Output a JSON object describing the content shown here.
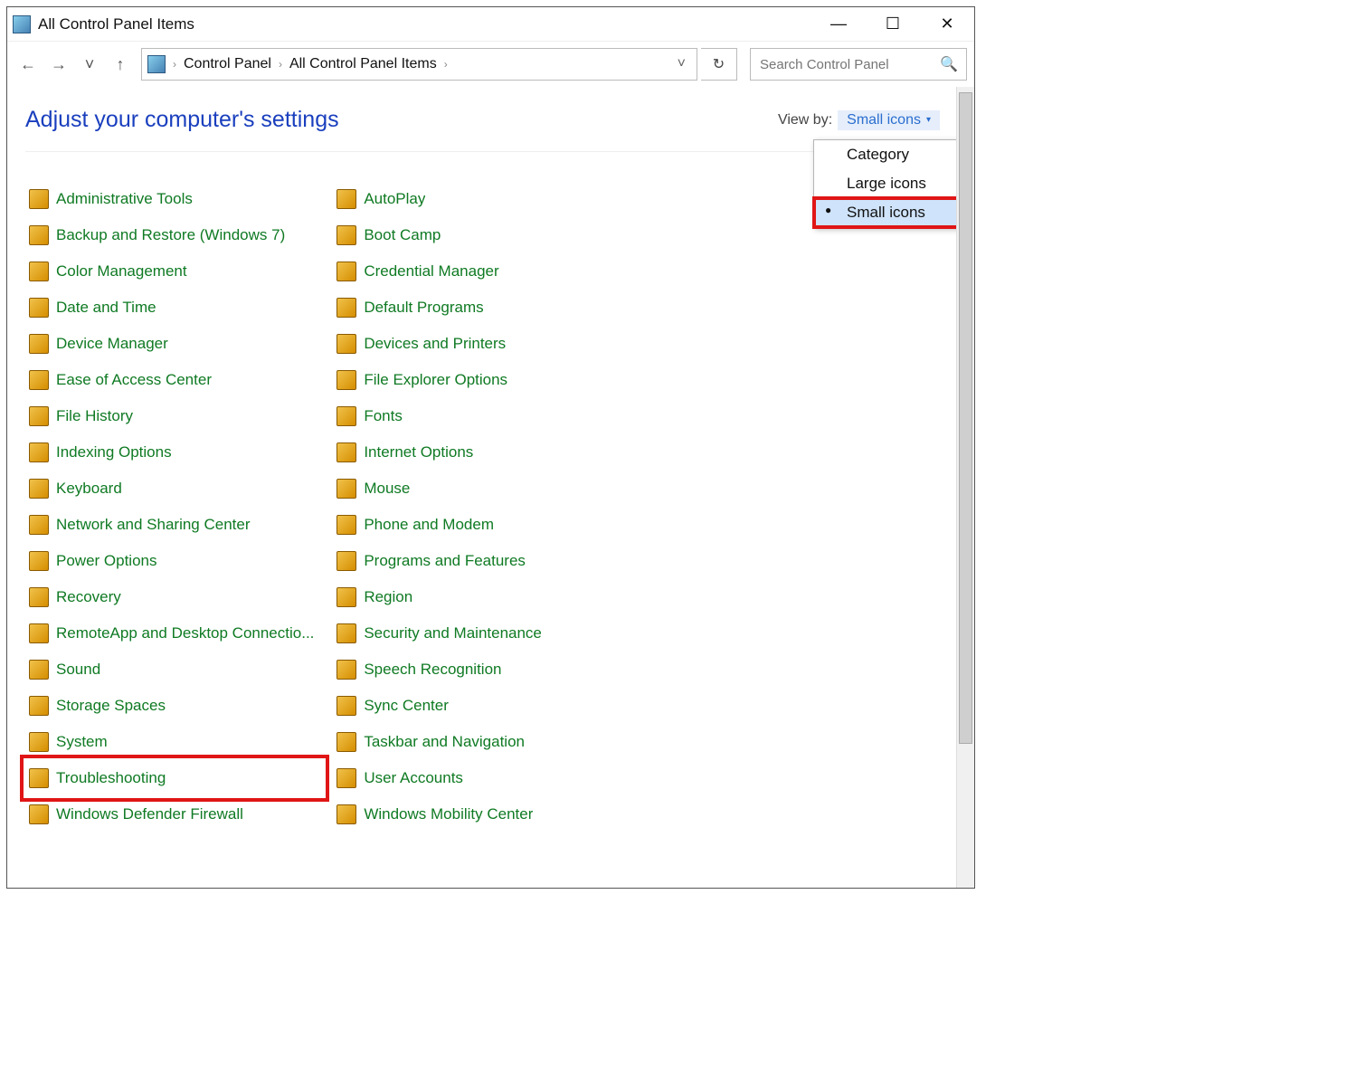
{
  "window": {
    "title": "All Control Panel Items",
    "controls": {
      "min": "—",
      "max": "☐",
      "close": "✕"
    }
  },
  "nav": {
    "back_icon": "←",
    "forward_icon": "→",
    "recent_icon": "˅",
    "up_icon": "↑",
    "refresh_icon": "↻"
  },
  "breadcrumb": {
    "items": [
      "Control Panel",
      "All Control Panel Items"
    ],
    "sep": "›"
  },
  "search": {
    "placeholder": "Search Control Panel"
  },
  "heading": "Adjust your computer's settings",
  "viewby": {
    "label": "View by:",
    "selected": "Small icons",
    "caret": "▾",
    "options": [
      "Category",
      "Large icons",
      "Small icons"
    ]
  },
  "items_col1": [
    "Administrative Tools",
    "Backup and Restore (Windows 7)",
    "Color Management",
    "Date and Time",
    "Device Manager",
    "Ease of Access Center",
    "File History",
    "Indexing Options",
    "Keyboard",
    "Network and Sharing Center",
    "Power Options",
    "Recovery",
    "RemoteApp and Desktop Connectio...",
    "Sound",
    "Storage Spaces",
    "System",
    "Troubleshooting",
    "Windows Defender Firewall"
  ],
  "items_col2": [
    "AutoPlay",
    "Boot Camp",
    "Credential Manager",
    "Default Programs",
    "Devices and Printers",
    "File Explorer Options",
    "Fonts",
    "Internet Options",
    "Mouse",
    "Phone and Modem",
    "Programs and Features",
    "Region",
    "Security and Maintenance",
    "Speech Recognition",
    "Sync Center",
    "Taskbar and Navigation",
    "User Accounts",
    "Windows Mobility Center"
  ],
  "highlighted_item": "Troubleshooting",
  "highlighted_option": "Small icons"
}
